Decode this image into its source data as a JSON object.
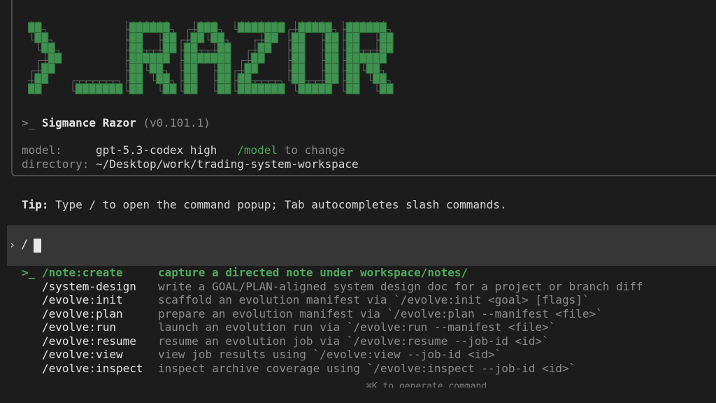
{
  "banner": {
    "logo_text": ">_RAZOR",
    "prompt_glyph": ">_",
    "app_name": "Sigmance Razor",
    "version": "(v0.101.1)",
    "model_label": "model:",
    "model_value": "gpt-5.3-codex high",
    "model_cmd": "/model",
    "model_hint": "to change",
    "dir_label": "directory:",
    "dir_value": "~/Desktop/work/trading-system-workspace"
  },
  "tip": {
    "label": "Tip:",
    "text": "Type / to open the command popup; Tab autocompletes slash commands."
  },
  "input": {
    "caret": "›",
    "value": "/"
  },
  "menu": {
    "selected_marker": ">_",
    "items": [
      {
        "cmd": "/note:create",
        "desc": "capture a directed note under workspace/notes/",
        "selected": true
      },
      {
        "cmd": "/system-design",
        "desc": "write a GOAL/PLAN-aligned system design doc for a project or branch diff"
      },
      {
        "cmd": "/evolve:init",
        "desc": "scaffold an evolution manifest via `/evolve:init <goal> [flags]`"
      },
      {
        "cmd": "/evolve:plan",
        "desc": "prepare an evolution manifest via `/evolve:plan --manifest <file>`"
      },
      {
        "cmd": "/evolve:run",
        "desc": "launch an evolution run via `/evolve:run --manifest <file>`"
      },
      {
        "cmd": "/evolve:resume",
        "desc": "resume an evolution job via `/evolve:resume --job-id <id>`"
      },
      {
        "cmd": "/evolve:view",
        "desc": "view job results using `/evolve:view --job-id <id>`"
      },
      {
        "cmd": "/evolve:inspect",
        "desc": "inspect archive coverage using `/evolve:inspect --job-id <id>`"
      }
    ]
  },
  "footer": {
    "hint": "⌘K to generate command"
  },
  "colors": {
    "background": "#1c1c1c",
    "accent_green": "#4faa5c",
    "input_bar": "#363636",
    "dim_text": "#8a8a8a"
  }
}
